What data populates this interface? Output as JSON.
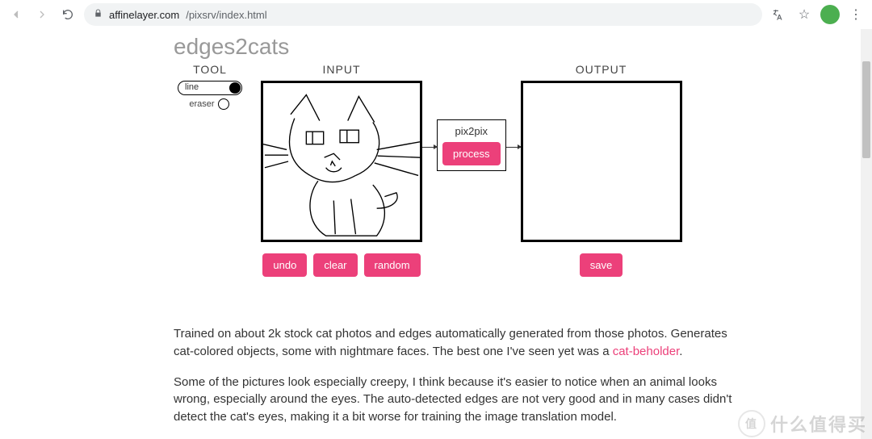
{
  "browser": {
    "url_host": "affinelayer.com",
    "url_path": "/pixsrv/index.html"
  },
  "page": {
    "title": "edges2cats",
    "headers": {
      "tool": "TOOL",
      "input": "INPUT",
      "output": "OUTPUT"
    },
    "tool": {
      "line_label": "line",
      "eraser_label": "eraser",
      "selected": "line"
    },
    "buttons": {
      "undo": "undo",
      "clear": "clear",
      "random": "random",
      "save": "save"
    },
    "processor": {
      "name": "pix2pix",
      "action": "process"
    },
    "paragraphs": {
      "p1_a": "Trained on about 2k stock cat photos and edges automatically generated from those photos. Generates cat-colored objects, some with nightmare faces. The best one I've seen yet was a ",
      "p1_link": "cat-beholder",
      "p1_b": ".",
      "p2": "Some of the pictures look especially creepy, I think because it's easier to notice when an animal looks wrong, especially around the eyes. The auto-detected edges are not very good and in many cases didn't detect the cat's eyes, making it a bit worse for training the image translation model."
    }
  },
  "watermark": {
    "big": "什么值得买",
    "small": "值"
  }
}
